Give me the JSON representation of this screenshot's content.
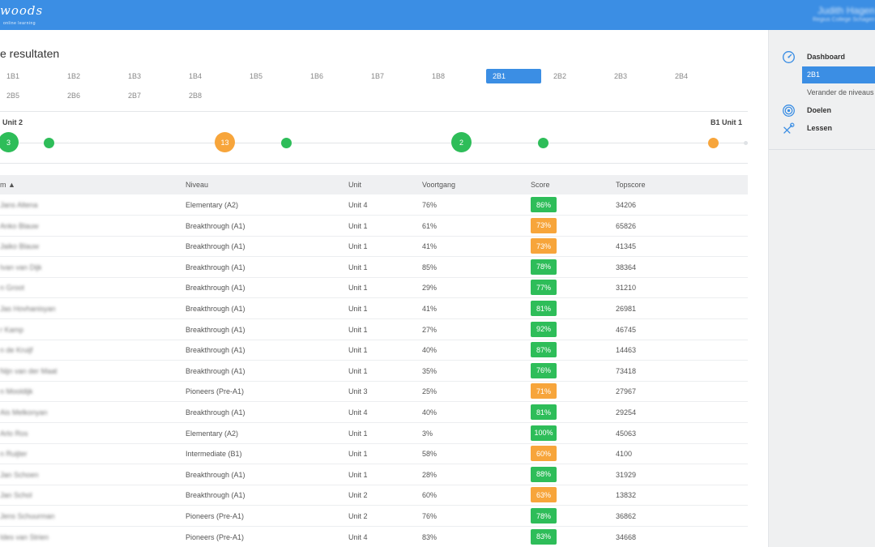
{
  "colors": {
    "primary": "#3b8ee4",
    "green": "#2ebd59",
    "orange": "#f7a53b"
  },
  "header": {
    "logo": "woods",
    "logo_sub": "online learning",
    "user_name": "Judith Hagen",
    "user_org": "Regius College Schagen"
  },
  "sidebar": {
    "dashboard": "Dashboard",
    "active_level": "2B1",
    "change_levels": "Verander de niveaus",
    "goals": "Doelen",
    "lessons": "Lessen"
  },
  "main": {
    "title": "e resultaten",
    "tabs": [
      "1B1",
      "1B2",
      "1B3",
      "1B4",
      "1B5",
      "1B6",
      "1B7",
      "1B8",
      "2B1",
      "2B2",
      "2B3",
      "2B4",
      "2B5",
      "2B6",
      "2B7",
      "2B8"
    ],
    "active_tab": "2B1",
    "timeline": {
      "start_label": "Unit 2",
      "end_label": "B1 Unit 1",
      "dot_labels": [
        "3",
        "13",
        "2"
      ]
    },
    "table": {
      "headers": {
        "name": "m ▲",
        "level": "Niveau",
        "unit": "Unit",
        "progress": "Voortgang",
        "score": "Score",
        "topscore": "Topscore"
      },
      "rows": [
        {
          "name": "Jans Altena",
          "level": "Elementary (A2)",
          "unit": "Unit 4",
          "progress": "76%",
          "score": "86%",
          "status": "green",
          "topscore": "34206"
        },
        {
          "name": "Anko Blauw",
          "level": "Breakthrough (A1)",
          "unit": "Unit 1",
          "progress": "61%",
          "score": "73%",
          "status": "orange",
          "topscore": "65826"
        },
        {
          "name": "Jaiko Blauw",
          "level": "Breakthrough (A1)",
          "unit": "Unit 1",
          "progress": "41%",
          "score": "73%",
          "status": "orange",
          "topscore": "41345"
        },
        {
          "name": "Ivan van Dijk",
          "level": "Breakthrough (A1)",
          "unit": "Unit 1",
          "progress": "85%",
          "score": "78%",
          "status": "green",
          "topscore": "38364"
        },
        {
          "name": "n Groot",
          "level": "Breakthrough (A1)",
          "unit": "Unit 1",
          "progress": "29%",
          "score": "77%",
          "status": "green",
          "topscore": "31210"
        },
        {
          "name": "Jas Hovhanisyan",
          "level": "Breakthrough (A1)",
          "unit": "Unit 1",
          "progress": "41%",
          "score": "81%",
          "status": "green",
          "topscore": "26981"
        },
        {
          "name": "r Kamp",
          "level": "Breakthrough (A1)",
          "unit": "Unit 1",
          "progress": "27%",
          "score": "92%",
          "status": "green",
          "topscore": "46745"
        },
        {
          "name": "n de Kruijf",
          "level": "Breakthrough (A1)",
          "unit": "Unit 1",
          "progress": "40%",
          "score": "87%",
          "status": "green",
          "topscore": "14463"
        },
        {
          "name": "Nijn van der Maat",
          "level": "Breakthrough (A1)",
          "unit": "Unit 1",
          "progress": "35%",
          "score": "76%",
          "status": "green",
          "topscore": "73418"
        },
        {
          "name": "n Mooldijk",
          "level": "Pioneers (Pre-A1)",
          "unit": "Unit 3",
          "progress": "25%",
          "score": "71%",
          "status": "orange",
          "topscore": "27967"
        },
        {
          "name": "Ais Melkonyan",
          "level": "Breakthrough (A1)",
          "unit": "Unit 4",
          "progress": "40%",
          "score": "81%",
          "status": "green",
          "topscore": "29254"
        },
        {
          "name": "Arlo Ros",
          "level": "Elementary (A2)",
          "unit": "Unit 1",
          "progress": "3%",
          "score": "100%",
          "status": "green",
          "topscore": "45063"
        },
        {
          "name": "n Ruijter",
          "level": "Intermediate (B1)",
          "unit": "Unit 1",
          "progress": "58%",
          "score": "60%",
          "status": "orange",
          "topscore": "4100"
        },
        {
          "name": "Jan Schoen",
          "level": "Breakthrough (A1)",
          "unit": "Unit 1",
          "progress": "28%",
          "score": "88%",
          "status": "green",
          "topscore": "31929"
        },
        {
          "name": "Jan Schol",
          "level": "Breakthrough (A1)",
          "unit": "Unit 2",
          "progress": "60%",
          "score": "63%",
          "status": "orange",
          "topscore": "13832"
        },
        {
          "name": "Jens Schuurman",
          "level": "Pioneers (Pre-A1)",
          "unit": "Unit 2",
          "progress": "76%",
          "score": "78%",
          "status": "green",
          "topscore": "36862"
        },
        {
          "name": "Ides van Strien",
          "level": "Pioneers (Pre-A1)",
          "unit": "Unit 4",
          "progress": "83%",
          "score": "83%",
          "status": "green",
          "topscore": "34668"
        }
      ]
    }
  }
}
